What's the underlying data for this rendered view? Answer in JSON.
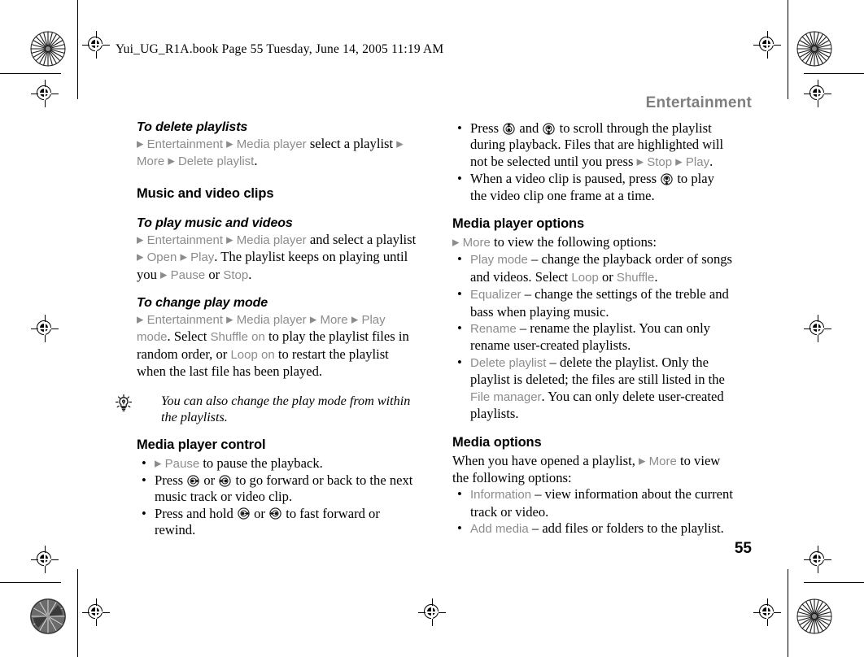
{
  "book_header": "Yui_UG_R1A.book  Page 55  Tuesday, June 14, 2005  11:19 AM",
  "running_head": "Entertainment",
  "page_number": "55",
  "colors": {
    "ui_term_gray": "#8c8c8c",
    "running_head_gray": "#7f7f7f",
    "body_black": "#000000"
  },
  "markers": {
    "arrow": "▶",
    "bullet": "•",
    "dash": "–"
  },
  "left_column": {
    "delete_playlists": {
      "heading": "To delete playlists",
      "line_1_ui_entertainment": "Entertainment",
      "line_1_ui_media_player": "Media player",
      "line_1_text_select": " select a playlist ",
      "line_2_ui_more": "More",
      "line_2_ui_delete_playlist": "Delete playlist",
      "line_2_period": "."
    },
    "music_and_video_clips": {
      "heading": "Music and video clips"
    },
    "play_music_and_videos": {
      "heading": "To play music and videos",
      "ui_entertainment": "Entertainment",
      "ui_media_player": "Media player",
      "text_and_select": " and select a playlist ",
      "ui_open": "Open",
      "ui_play": "Play",
      "text_keeps_playing": ". The playlist keeps on playing until you ",
      "ui_pause": "Pause",
      "text_or": " or ",
      "ui_stop": "Stop",
      "period": "."
    },
    "change_play_mode": {
      "heading": "To change play mode",
      "ui_entertainment": "Entertainment",
      "ui_media_player": "Media player",
      "ui_more": "More",
      "ui_play_mode": "Play mode",
      "text_select": ". Select ",
      "ui_shuffle_on": "Shuffle on",
      "text_random": " to play the playlist files in random order, or ",
      "ui_loop_on": "Loop on",
      "text_restart": " to restart the playlist when the last file has been played."
    },
    "tip": {
      "icon": "lightbulb-icon",
      "text": "You can also change the play mode from within the playlists."
    },
    "media_player_control": {
      "heading": "Media player control",
      "items": [
        {
          "ui_pause": "Pause",
          "text_after": " to pause the playback."
        },
        {
          "text_before": "Press ",
          "key_1": "nav-key-right",
          "text_middle": " or ",
          "key_2": "nav-key-left",
          "text_after": " to go forward or back to the next music track or video clip."
        },
        {
          "text_before": "Press and hold ",
          "key_1": "nav-key-right",
          "text_middle": " or ",
          "key_2": "nav-key-left",
          "text_after": " to fast forward or rewind."
        }
      ]
    }
  },
  "right_column": {
    "top_bullets": [
      {
        "text_before": "Press ",
        "key_1": "nav-key-up",
        "text_middle": " and ",
        "key_2": "nav-key-down",
        "text_after": " to scroll through the playlist during playback. Files that are highlighted will not be selected until you press ",
        "ui_stop": "Stop",
        "ui_play": "Play",
        "period": "."
      },
      {
        "text_before": "When a video clip is paused, press ",
        "key_1": "nav-key-down",
        "text_after": " to play the video clip one frame at a time."
      }
    ],
    "media_player_options": {
      "heading": "Media player options",
      "intro_ui_more": "More",
      "intro_text": " to view the following options:",
      "items": [
        {
          "term": "Play mode",
          "text_1": " – change the playback order of songs and videos. Select ",
          "ui_loop": "Loop",
          "text_2": " or ",
          "ui_shuffle": "Shuffle",
          "text_3": "."
        },
        {
          "term": "Equalizer",
          "text_1": " – change the settings of the treble and bass when playing music."
        },
        {
          "term": "Rename",
          "text_1": " – rename the playlist. You can only rename user-created playlists."
        },
        {
          "term": "Delete playlist",
          "text_1": " – delete the playlist. Only the playlist is deleted; the files are still listed in the ",
          "ui_file_manager": "File manager",
          "text_2": ". You can only delete user-created playlists."
        }
      ]
    },
    "media_options": {
      "heading": "Media options",
      "intro_before": "When you have opened a playlist, ",
      "intro_ui_more": "More",
      "intro_after": " to view the following options:",
      "items": [
        {
          "term": "Information",
          "text_1": " – view information about the current track or video."
        },
        {
          "term": "Add media",
          "text_1": " – add files or folders to the playlist."
        }
      ]
    }
  }
}
